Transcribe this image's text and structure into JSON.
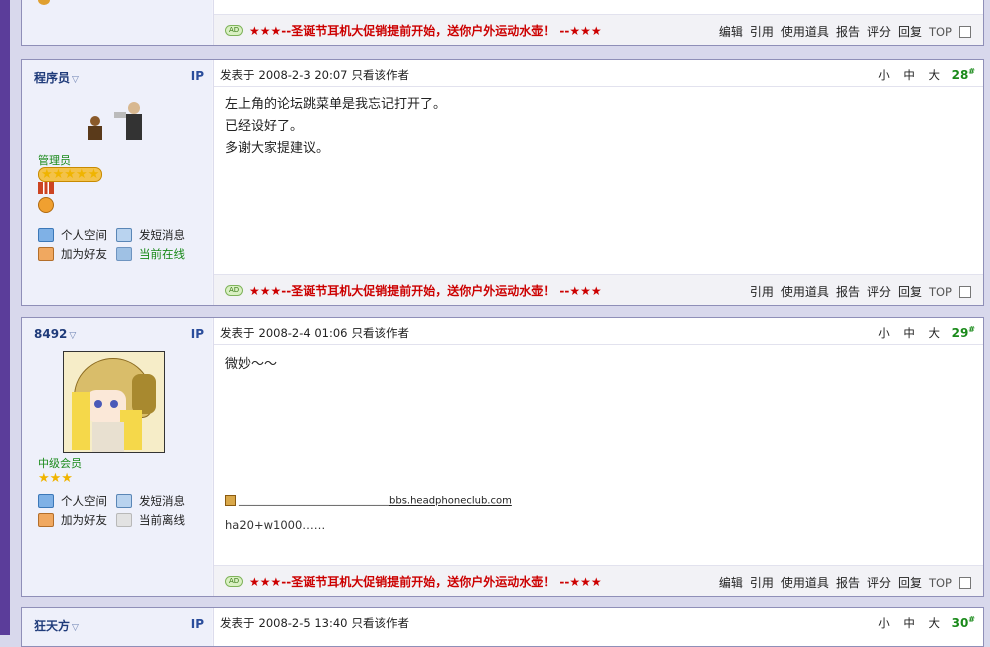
{
  "ad": {
    "badge": "AD",
    "text": "★★★--圣诞节耳机大促销提前开始，送你户外运动水壶！  --★★★"
  },
  "actions": {
    "edit": "编辑",
    "quote": "引用",
    "use_item": "使用道具",
    "report": "报告",
    "rate": "评分",
    "reply": "回复",
    "top": "TOP"
  },
  "font_sizes": "小 中 大",
  "meta_label": "发表于",
  "author_only": "只看该作者",
  "links": {
    "space": "个人空间",
    "pm": "发短消息",
    "add_friend": "加为好友",
    "online": "当前在线",
    "offline": "当前离线"
  },
  "posts": [
    {
      "user": "程序员",
      "ip": "IP",
      "rank": "管理员",
      "stars": 5,
      "date": "2008-2-3 20:07",
      "floor": "28",
      "lines": [
        "左上角的论坛跳菜单是我忘记打开了。",
        "已经设好了。",
        "多谢大家提建议。"
      ],
      "status": "当前在线"
    },
    {
      "user": "8492",
      "ip": "IP",
      "rank": "中级会员",
      "stars": 3,
      "date": "2008-2-4 01:06",
      "floor": "29",
      "lines": [
        "微妙～～"
      ],
      "status": "当前离线",
      "signature": {
        "dashes": "______________________________",
        "site": "bbs.headphoneclub.com",
        "note": "ha20+w1000……"
      }
    },
    {
      "user": "狂天方",
      "ip": "IP",
      "date": "2008-2-5 13:40",
      "floor": "30"
    }
  ],
  "colors": {
    "accent_green": "#1a8a1a",
    "ad_red": "#cc0000",
    "frame": "#8f8fb8",
    "username": "#1f3b7a"
  }
}
